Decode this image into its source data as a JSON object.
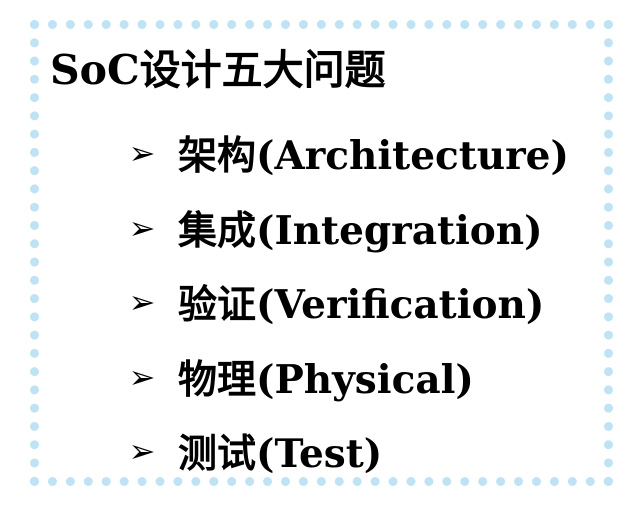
{
  "slide": {
    "title": "SoC设计五大问题",
    "bullet_icon": "arrowhead-bullet-icon",
    "bullet_glyph": "➢",
    "items": [
      {
        "label": "架构(Architecture)"
      },
      {
        "label": "集成(Integration)"
      },
      {
        "label": "验证(Verification)"
      },
      {
        "label": "物理(Physical)"
      },
      {
        "label": "测试(Test)"
      }
    ]
  },
  "colors": {
    "frame_dots": "#bfe3f5",
    "text": "#000000",
    "background": "#ffffff"
  }
}
